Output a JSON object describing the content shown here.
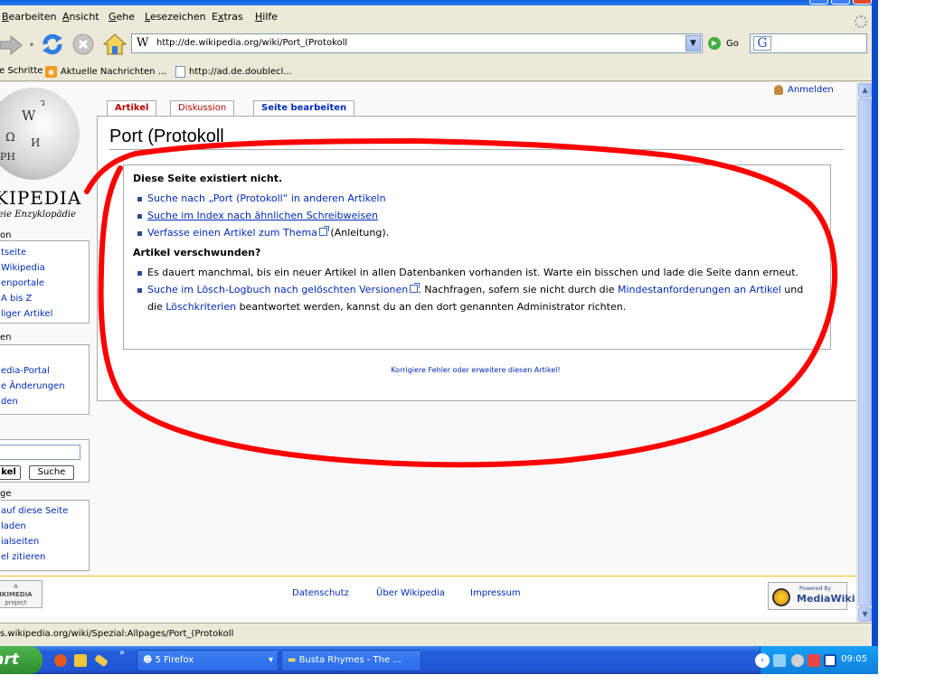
{
  "menu": {
    "items": [
      "Bearbeiten",
      "Ansicht",
      "Gehe",
      "Lesezeichen",
      "Extras",
      "Hilfe"
    ],
    "underlines": [
      "B",
      "A",
      "G",
      "L",
      "x",
      "H"
    ]
  },
  "navigation": {
    "url": "http://de.wikipedia.org/wiki/Port_(Protokoll",
    "go_label": "Go",
    "search_engine": "G"
  },
  "bookmarks": {
    "items": [
      "e Schritte",
      "Aktuelle Nachrichten ...",
      "http://ad.de.doublecl..."
    ]
  },
  "wiki": {
    "logo_title": "KIPEDIA",
    "logo_subtitle": "eie Enzyklopädie",
    "anmelden": "Anmelden",
    "tabs": [
      "Artikel",
      "Diskussion",
      "Seite bearbeiten"
    ],
    "heading": "Port (Protokoll",
    "nav_heading": "on",
    "nav_items": [
      "tseite",
      "Wikipedia",
      "enportale",
      "A bis Z",
      "liger Artikel"
    ],
    "participate_heading": "en",
    "participate_items": [
      "edia-Portal",
      "e Änderungen",
      "den"
    ],
    "search_buttons": [
      "kel",
      "Suche"
    ],
    "tools_heading": "ge",
    "tools_items": [
      "auf diese Seite",
      "laden",
      "ialseiten",
      "el zitieren"
    ],
    "noarticle": {
      "title": "Diese Seite existiert nicht.",
      "links": [
        "Suche nach „Port (Protokoll“ in anderen Artikeln",
        "Suche im Index nach ähnlichen Schreibweisen",
        "Verfasse einen Artikel zum Thema"
      ],
      "anleitung": "(Anleitung).",
      "title2": "Artikel verschwunden?",
      "item1": "Es dauert manchmal, bis ein neuer Artikel in allen Datenbanken vorhanden ist. Warte ein bisschen und lade die Seite dann erneut.",
      "item2_link": "Suche im Lösch-Logbuch nach gelöschten Versionen",
      "item2_text_a": ". Nachfragen, sofern sie nicht durch die ",
      "item2_link2": "Mindestanforderungen an Artikel",
      "item2_text_b": " und die ",
      "item2_link3": "Löschkriterien",
      "item2_text_c": " beantwortet werden, kannst du an den dort genannten Administrator richten."
    },
    "fix_note": "Korrigiere Fehler oder erweitere diesen Artikel!",
    "footer_links": [
      "Datenschutz",
      "Über Wikipedia",
      "Impressum"
    ],
    "wm_logo": "IKIMEDIA",
    "wm_project": "project",
    "mw_powered": "Powered By",
    "mw_name": "MediaWiki"
  },
  "status": {
    "text": "s.wikipedia.org/wiki/Spezial:Allpages/Port_(Protokoll"
  },
  "taskbar": {
    "start": "art",
    "items": [
      "5 Firefox",
      "Busta Rhymes - The ..."
    ],
    "clock": "09:05"
  },
  "colors": {
    "link": "#002bb8",
    "new_tab": "#ba0000",
    "annotation": "#ff0000",
    "taskbar": "#245edb"
  }
}
